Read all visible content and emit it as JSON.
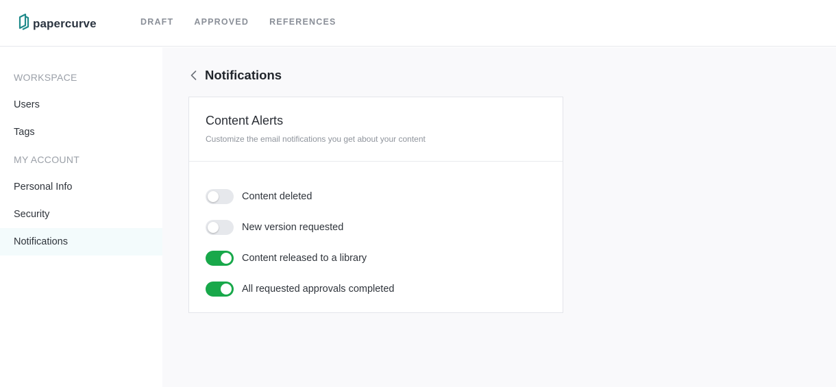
{
  "brand": {
    "name": "papercurve",
    "accent": "#1f8a8a"
  },
  "topnav": {
    "items": [
      "DRAFT",
      "APPROVED",
      "REFERENCES"
    ]
  },
  "sidebar": {
    "workspace_heading": "WORKSPACE",
    "account_heading": "MY ACCOUNT",
    "items": [
      "Users",
      "Tags",
      "Personal Info",
      "Security",
      "Notifications"
    ],
    "active": "Notifications"
  },
  "page": {
    "title": "Notifications",
    "back_icon": "chevron-left-icon"
  },
  "card": {
    "title": "Content Alerts",
    "subtitle": "Customize the email notifications you get about your content",
    "settings": [
      {
        "label": "Content deleted",
        "enabled": false
      },
      {
        "label": "New version requested",
        "enabled": false
      },
      {
        "label": "Content released to a library",
        "enabled": true
      },
      {
        "label": "All requested approvals completed",
        "enabled": true
      }
    ]
  },
  "colors": {
    "toggle_on": "#18a84a",
    "toggle_off": "#e6e8ec",
    "active_item_bg": "#f3fbfc"
  }
}
